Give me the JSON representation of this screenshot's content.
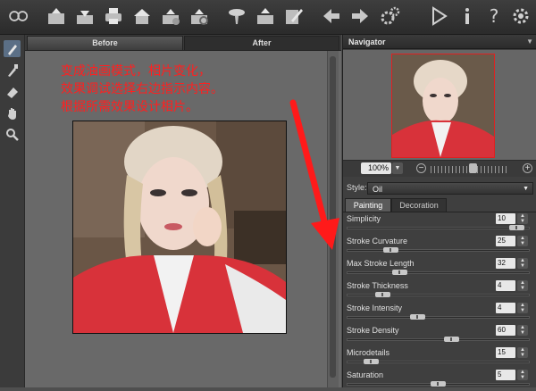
{
  "toolbar": {
    "icons": [
      "logo-icon",
      "open-icon",
      "save-icon",
      "print-icon",
      "home-icon",
      "batch-icon",
      "settings-icon",
      "brush-icon",
      "share-icon",
      "edit-icon",
      "undo-icon",
      "redo-icon",
      "gears-icon",
      "play-icon",
      "info-icon",
      "help-icon",
      "preferences-icon"
    ]
  },
  "tools": [
    "brush-tool-icon",
    "paint-tool-icon",
    "eraser-icon",
    "hand-icon",
    "zoom-icon"
  ],
  "canvas": {
    "tab_before": "Before",
    "tab_after": "After",
    "annotation": [
      "变成油画模式，相片变化，",
      "效果调试选择右边指示内容。",
      "根据所需效果设计相片。"
    ]
  },
  "navigator": {
    "title": "Navigator",
    "zoom": "100%",
    "zoom_level": 0.55
  },
  "style": {
    "label": "Style:",
    "value": "Oil"
  },
  "subtabs": {
    "painting": "Painting",
    "decoration": "Decoration"
  },
  "params": [
    {
      "label": "Simplicity",
      "value": "10",
      "level": 0.97
    },
    {
      "label": "Stroke Curvature",
      "value": "25",
      "level": 0.22
    },
    {
      "label": "Max Stroke Length",
      "value": "32",
      "level": 0.27
    },
    {
      "label": "Stroke Thickness",
      "value": "4",
      "level": 0.17
    },
    {
      "label": "Stroke Intensity",
      "value": "4",
      "level": 0.38
    },
    {
      "label": "Stroke Density",
      "value": "60",
      "level": 0.58
    },
    {
      "label": "Microdetails",
      "value": "15",
      "level": 0.1
    },
    {
      "label": "Saturation",
      "value": "5",
      "level": 0.5
    }
  ],
  "colors": {
    "annotation": "#ff2020",
    "arrow": "#ff1a1a",
    "navigator_frame": "#e02020"
  }
}
